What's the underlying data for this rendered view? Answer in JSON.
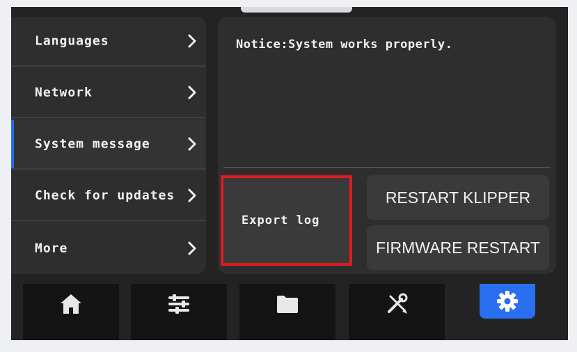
{
  "sidebar": {
    "items": [
      {
        "label": "Languages"
      },
      {
        "label": "Network"
      },
      {
        "label": "System message",
        "active": true
      },
      {
        "label": "Check for updates"
      },
      {
        "label": "More"
      }
    ]
  },
  "panel": {
    "notice": "Notice:System works properly.",
    "export_label": "Export log",
    "restart_klipper_label": "RESTART KLIPPER",
    "firmware_restart_label": "FIRMWARE RESTART"
  },
  "navbar": {
    "items": [
      {
        "icon": "home-icon"
      },
      {
        "icon": "sliders-icon"
      },
      {
        "icon": "folder-icon"
      },
      {
        "icon": "tools-icon"
      },
      {
        "icon": "gear-icon",
        "active": true
      }
    ]
  },
  "colors": {
    "accent": "#2a6ff0",
    "highlight_border": "#e01b24",
    "background": "#232323",
    "panel": "#2e2e2e"
  }
}
